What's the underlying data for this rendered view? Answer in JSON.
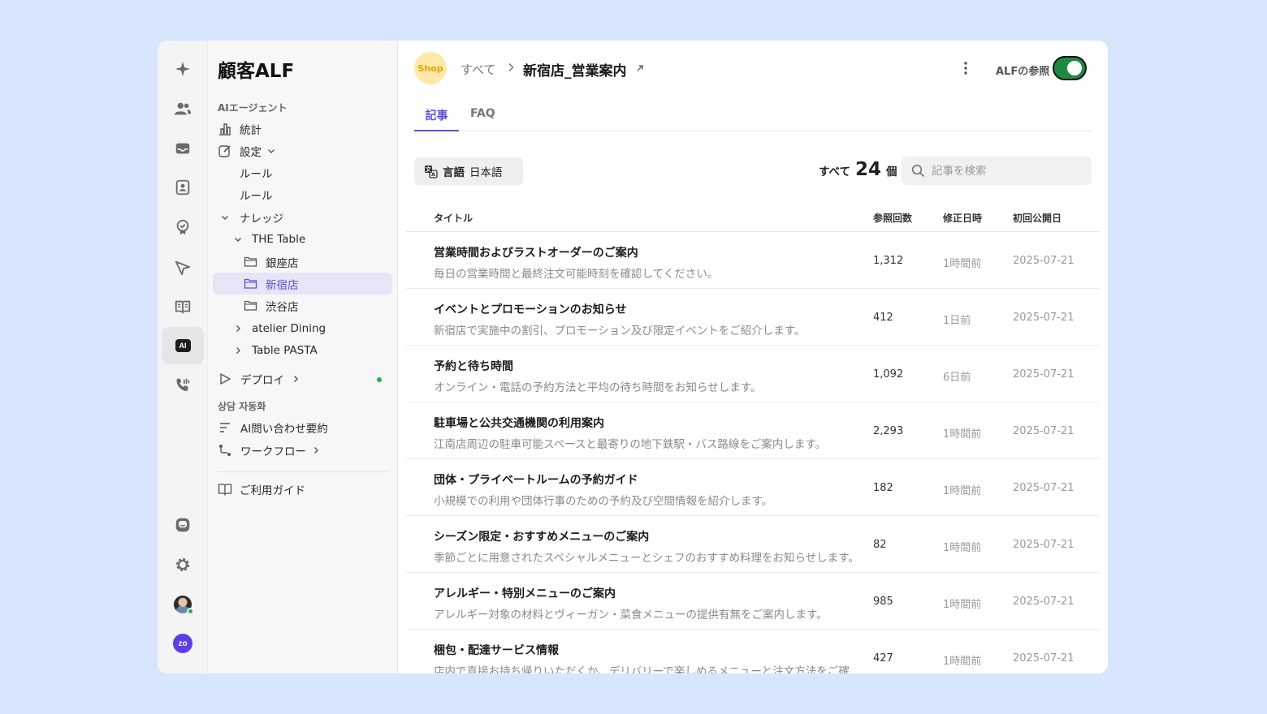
{
  "sidebar": {
    "title": "顧客ALF",
    "section_ai": "AIエージェント",
    "stats": "統計",
    "settings": "設定",
    "rule1": "ルール",
    "rule2": "ルール",
    "knowledge": "ナレッジ",
    "the_table": "THE Table",
    "ginza": "銀座店",
    "shinjuku": "新宿店",
    "shibuya": "渋谷店",
    "atelier": "atelier Dining",
    "pasta": "Table PASTA",
    "deploy": "デプロイ",
    "section_consult": "상담 자동화",
    "ai_summary": "AI問い合わせ要約",
    "workflow": "ワークフロー",
    "guide": "ご利用ガイド"
  },
  "header": {
    "shop_logo": "Shop",
    "crumb_root": "すべて",
    "crumb_current": "新宿店_営業案内",
    "ref_label": "ALFの参照",
    "toggle_on": true
  },
  "tabs": [
    "記事",
    "FAQ"
  ],
  "toolbar": {
    "lang_label": "言語",
    "lang_value": "日本語",
    "count_prefix": "すべて",
    "count_value": "24",
    "count_suffix": "個",
    "search_placeholder": "記事を検索"
  },
  "table": {
    "headers": {
      "title": "タイトル",
      "views": "参照回数",
      "modified": "修正日時",
      "published": "初回公開日"
    },
    "rows": [
      {
        "title": "営業時間およびラストオーダーのご案内",
        "desc": "毎日の営業時間と最終注文可能時刻を確認してください。",
        "views": "1,312",
        "modified": "1時間前",
        "published": "2025-07-21"
      },
      {
        "title": "イベントとプロモーションのお知らせ",
        "desc": "新宿店で実施中の割引、プロモーション及び限定イベントをご紹介します。",
        "views": "412",
        "modified": "1日前",
        "published": "2025-07-21"
      },
      {
        "title": "予約と待ち時間",
        "desc": "オンライン・電話の予約方法と平均の待ち時間をお知らせします。",
        "views": "1,092",
        "modified": "6日前",
        "published": "2025-07-21"
      },
      {
        "title": "駐車場と公共交通機関の利用案内",
        "desc": "江南店周辺の駐車可能スペースと最寄りの地下鉄駅・バス路線をご案内します。",
        "views": "2,293",
        "modified": "1時間前",
        "published": "2025-07-21"
      },
      {
        "title": "団体・プライベートルームの予約ガイド",
        "desc": "小規模での利用や団体行事のための予約及び空間情報を紹介します。",
        "views": "182",
        "modified": "1時間前",
        "published": "2025-07-21"
      },
      {
        "title": "シーズン限定・おすすめメニューのご案内",
        "desc": "季節ごとに用意されたスペシャルメニューとシェフのおすすめ料理をお知らせします。",
        "views": "82",
        "modified": "1時間前",
        "published": "2025-07-21"
      },
      {
        "title": "アレルギー・特別メニューのご案内",
        "desc": "アレルギー対象の材料とヴィーガン・菜食メニューの提供有無をご案内します。",
        "views": "985",
        "modified": "1時間前",
        "published": "2025-07-21"
      },
      {
        "title": "梱包・配達サービス情報",
        "desc": "店内で直接お持ち帰りいただくか、デリバリーで楽しめるメニューと注文方法をご確",
        "views": "427",
        "modified": "1時間前",
        "published": "2025-07-21"
      }
    ]
  },
  "colors": {
    "accent": "#5b4fd6",
    "toggle": "#1f8a3f",
    "page_bg": "#d7e5ff"
  }
}
